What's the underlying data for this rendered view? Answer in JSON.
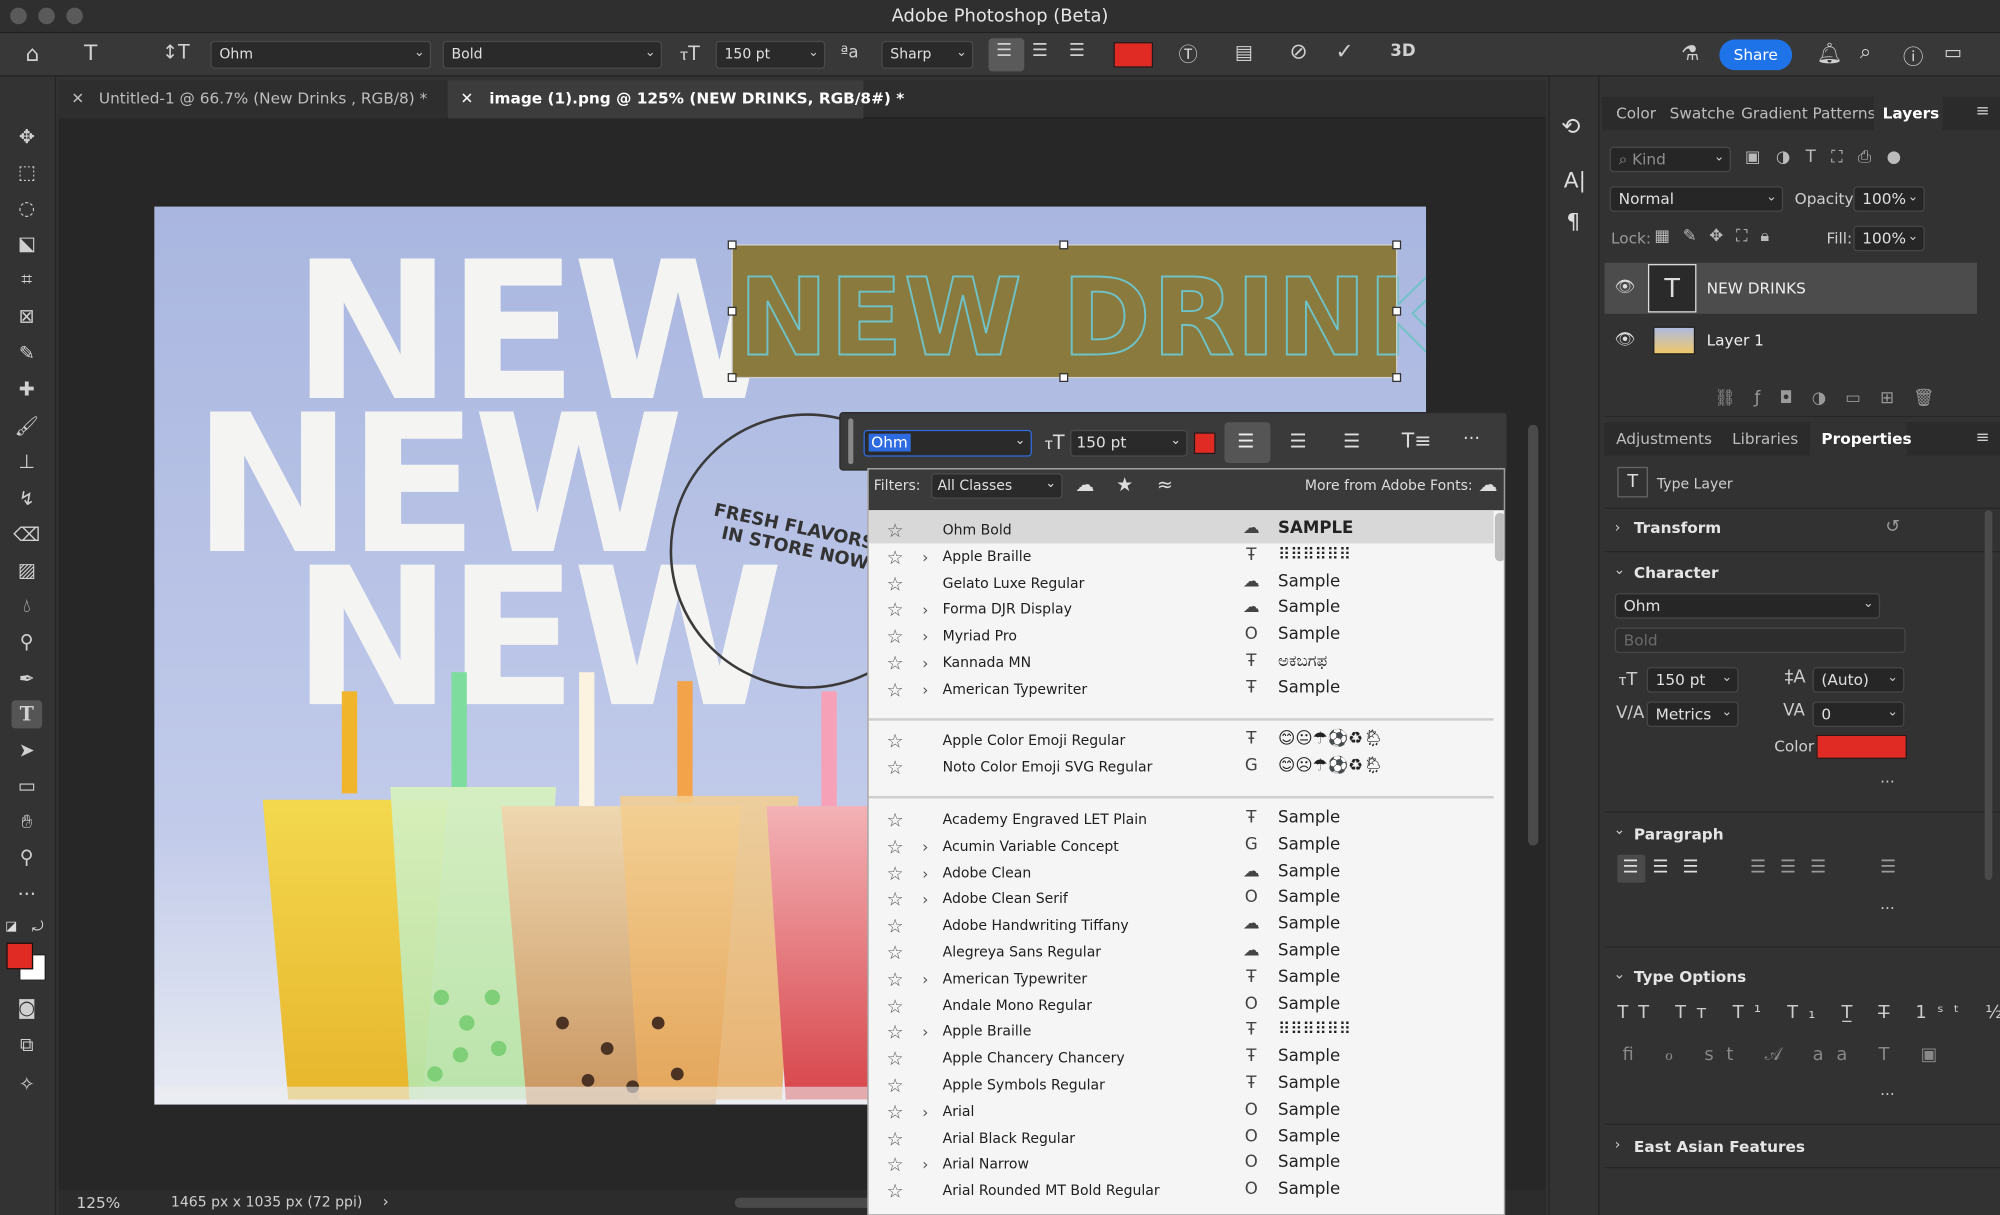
{
  "app": {
    "title": "Adobe Photoshop (Beta)"
  },
  "options": {
    "font_family": "Ohm",
    "font_style": "Bold",
    "font_size": "150 pt",
    "antialias_symbol": "ªa",
    "antialias": "Sharp",
    "text_color": "#e02a24",
    "share_label": "Share"
  },
  "tabs": [
    {
      "label": "Untitled-1 @ 66.7% (New  Drinks , RGB/8) *",
      "active": false
    },
    {
      "label": "image (1).png @ 125% (NEW DRINKS, RGB/8#) *",
      "active": true
    }
  ],
  "canvas": {
    "big_word": "NEW",
    "headline": "NEW DRINKS",
    "badge_line1": "FRESH FLAVORS",
    "badge_line2": "IN STORE NOW"
  },
  "status": {
    "zoom": "125%",
    "doc_size": "1465 px x 1035 px (72 ppi)",
    "arrow": "›"
  },
  "context_bar": {
    "font": "Ohm",
    "size": "150 pt",
    "color": "#e02a24",
    "more": "···"
  },
  "font_panel": {
    "filters_label": "Filters:",
    "filter_value": "All Classes",
    "more_fonts": "More from Adobe Fonts:",
    "recent": [
      {
        "name": "Ohm Bold",
        "type": "cloud",
        "sample": "SAMPLE",
        "expand": false
      },
      {
        "name": "Apple Braille",
        "type": "tt",
        "sample": "⠿⠿⠿⠿⠿⠿",
        "expand": true
      },
      {
        "name": "Gelato Luxe Regular",
        "type": "cloud",
        "sample": "Sample",
        "expand": false
      },
      {
        "name": "Forma DJR Display",
        "type": "cloud",
        "sample": "Sample",
        "expand": true
      },
      {
        "name": "Myriad Pro",
        "type": "o",
        "sample": "Sample",
        "expand": true
      },
      {
        "name": "Kannada MN",
        "type": "tt",
        "sample": "ಅಕಬಗಫ",
        "expand": true
      },
      {
        "name": "American Typewriter",
        "type": "tt",
        "sample": "Sample",
        "expand": true
      }
    ],
    "emoji": [
      {
        "name": "Apple Color Emoji Regular",
        "type": "tt",
        "sample": "😊😐☂⚽♻🌦",
        "expand": false
      },
      {
        "name": "Noto Color Emoji SVG Regular",
        "type": "svg",
        "sample": "😊☹☂⚽♻🌦",
        "expand": false
      }
    ],
    "all": [
      {
        "name": "Academy Engraved LET Plain",
        "type": "tt",
        "sample": "Sample",
        "expand": false
      },
      {
        "name": "Acumin Variable Concept",
        "type": "var",
        "sample": "Sample",
        "expand": true
      },
      {
        "name": "Adobe Clean",
        "type": "cloud",
        "sample": "Sample",
        "expand": true
      },
      {
        "name": "Adobe Clean Serif",
        "type": "o",
        "sample": "Sample",
        "expand": true
      },
      {
        "name": "Adobe Handwriting Tiffany",
        "type": "cloud",
        "sample": "Sample",
        "expand": false
      },
      {
        "name": "Alegreya Sans Regular",
        "type": "cloud",
        "sample": "Sample",
        "expand": false
      },
      {
        "name": "American Typewriter",
        "type": "tt",
        "sample": "Sample",
        "expand": true
      },
      {
        "name": "Andale Mono Regular",
        "type": "o",
        "sample": "Sample",
        "expand": false
      },
      {
        "name": "Apple Braille",
        "type": "tt",
        "sample": "⠿⠿⠿⠿⠿⠿",
        "expand": true
      },
      {
        "name": "Apple Chancery Chancery",
        "type": "tt",
        "sample": "Sample",
        "expand": false
      },
      {
        "name": "Apple Symbols Regular",
        "type": "tt",
        "sample": "Sample",
        "expand": false
      },
      {
        "name": "Arial",
        "type": "o",
        "sample": "Sample",
        "expand": true
      },
      {
        "name": "Arial Black Regular",
        "type": "o",
        "sample": "Sample",
        "expand": false
      },
      {
        "name": "Arial Narrow",
        "type": "o",
        "sample": "Sample",
        "expand": true
      },
      {
        "name": "Arial Rounded MT Bold Regular",
        "type": "o",
        "sample": "Sample",
        "expand": false
      }
    ]
  },
  "panel_tabs": {
    "color": "Color",
    "swatches": "Swatche",
    "gradients": "Gradient",
    "patterns": "Patterns",
    "layers": "Layers"
  },
  "layers": {
    "kind": "Kind",
    "blend": "Normal",
    "opacity_label": "Opacity:",
    "opacity": "100%",
    "lock_label": "Lock:",
    "fill_label": "Fill:",
    "fill": "100%",
    "items": [
      {
        "name": "NEW DRINKS",
        "selected": true
      },
      {
        "name": "Layer 1",
        "selected": false
      }
    ]
  },
  "props_tabs": {
    "adjustments": "Adjustments",
    "libraries": "Libraries",
    "properties": "Properties"
  },
  "properties": {
    "kind": "Type Layer",
    "transform": "Transform",
    "character": "Character",
    "font": "Ohm",
    "style": "Bold",
    "size": "150 pt",
    "leading": "(Auto)",
    "kerning": "Metrics",
    "tracking": "0",
    "color_label": "Color",
    "color": "#e02a24",
    "paragraph": "Paragraph",
    "type_options": "Type Options",
    "east_asian": "East Asian Features",
    "more": "···"
  }
}
